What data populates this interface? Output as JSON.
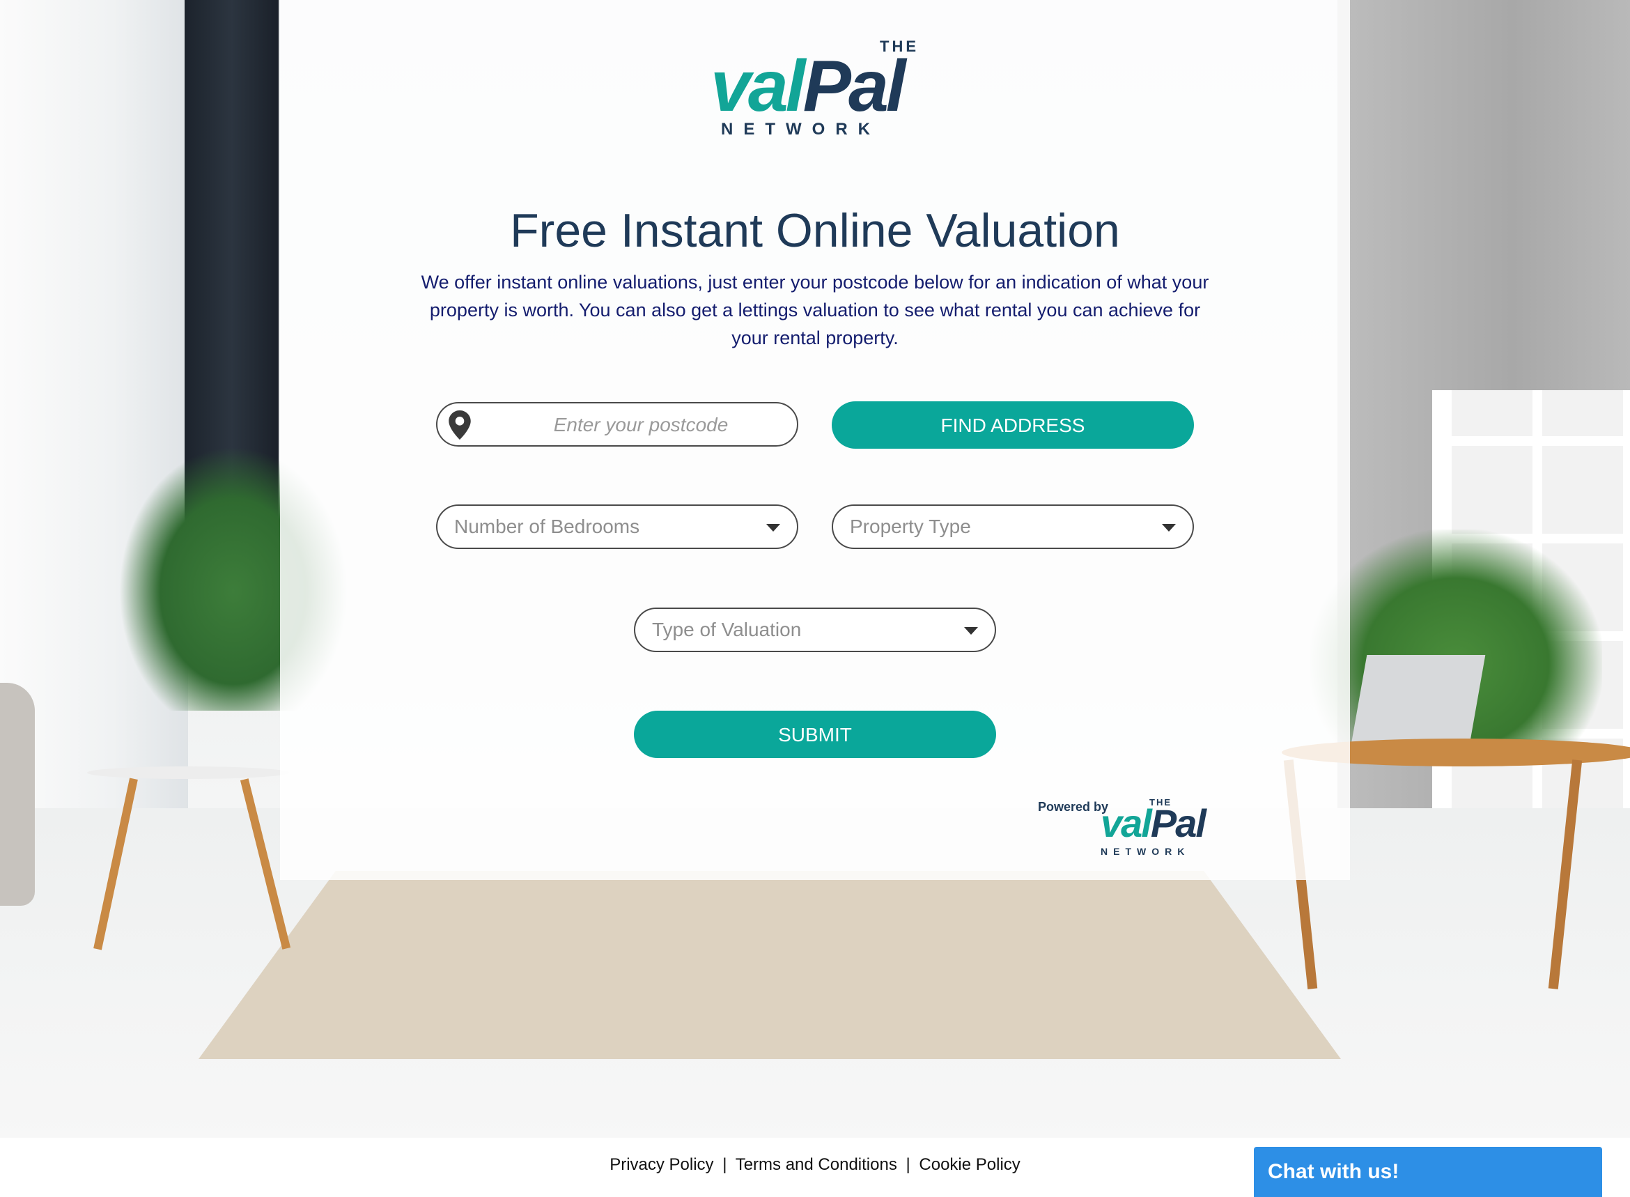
{
  "logo": {
    "the": "THE",
    "word_accent": "val",
    "word_main": "Pal",
    "network": "NETWORK"
  },
  "page": {
    "title": "Free Instant Online Valuation",
    "intro": "We offer instant online valuations, just enter your postcode below for an indication of what your property is worth. You can also get a lettings valuation to see what rental you can achieve for your rental property."
  },
  "form": {
    "postcode_placeholder": "Enter your postcode",
    "postcode_value": "",
    "pin_icon": "map-pin-icon",
    "find_address_label": "FIND ADDRESS",
    "bedrooms_selected": "Number of Bedrooms",
    "property_type_selected": "Property Type",
    "valuation_type_selected": "Type of Valuation",
    "submit_label": "SUBMIT"
  },
  "powered_by": {
    "label": "Powered by",
    "the": "THE",
    "word_accent": "val",
    "word_main": "Pal",
    "network": "NETWORK"
  },
  "footer": {
    "privacy": "Privacy Policy",
    "terms": "Terms and Conditions",
    "cookie": "Cookie Policy",
    "separator": "|"
  },
  "chat": {
    "label": "Chat with us!"
  },
  "colors": {
    "accent": "#0aa79a",
    "brand_navy": "#1f3a58",
    "intro_text": "#141d6e",
    "chat_blue": "#2d8fe6"
  }
}
